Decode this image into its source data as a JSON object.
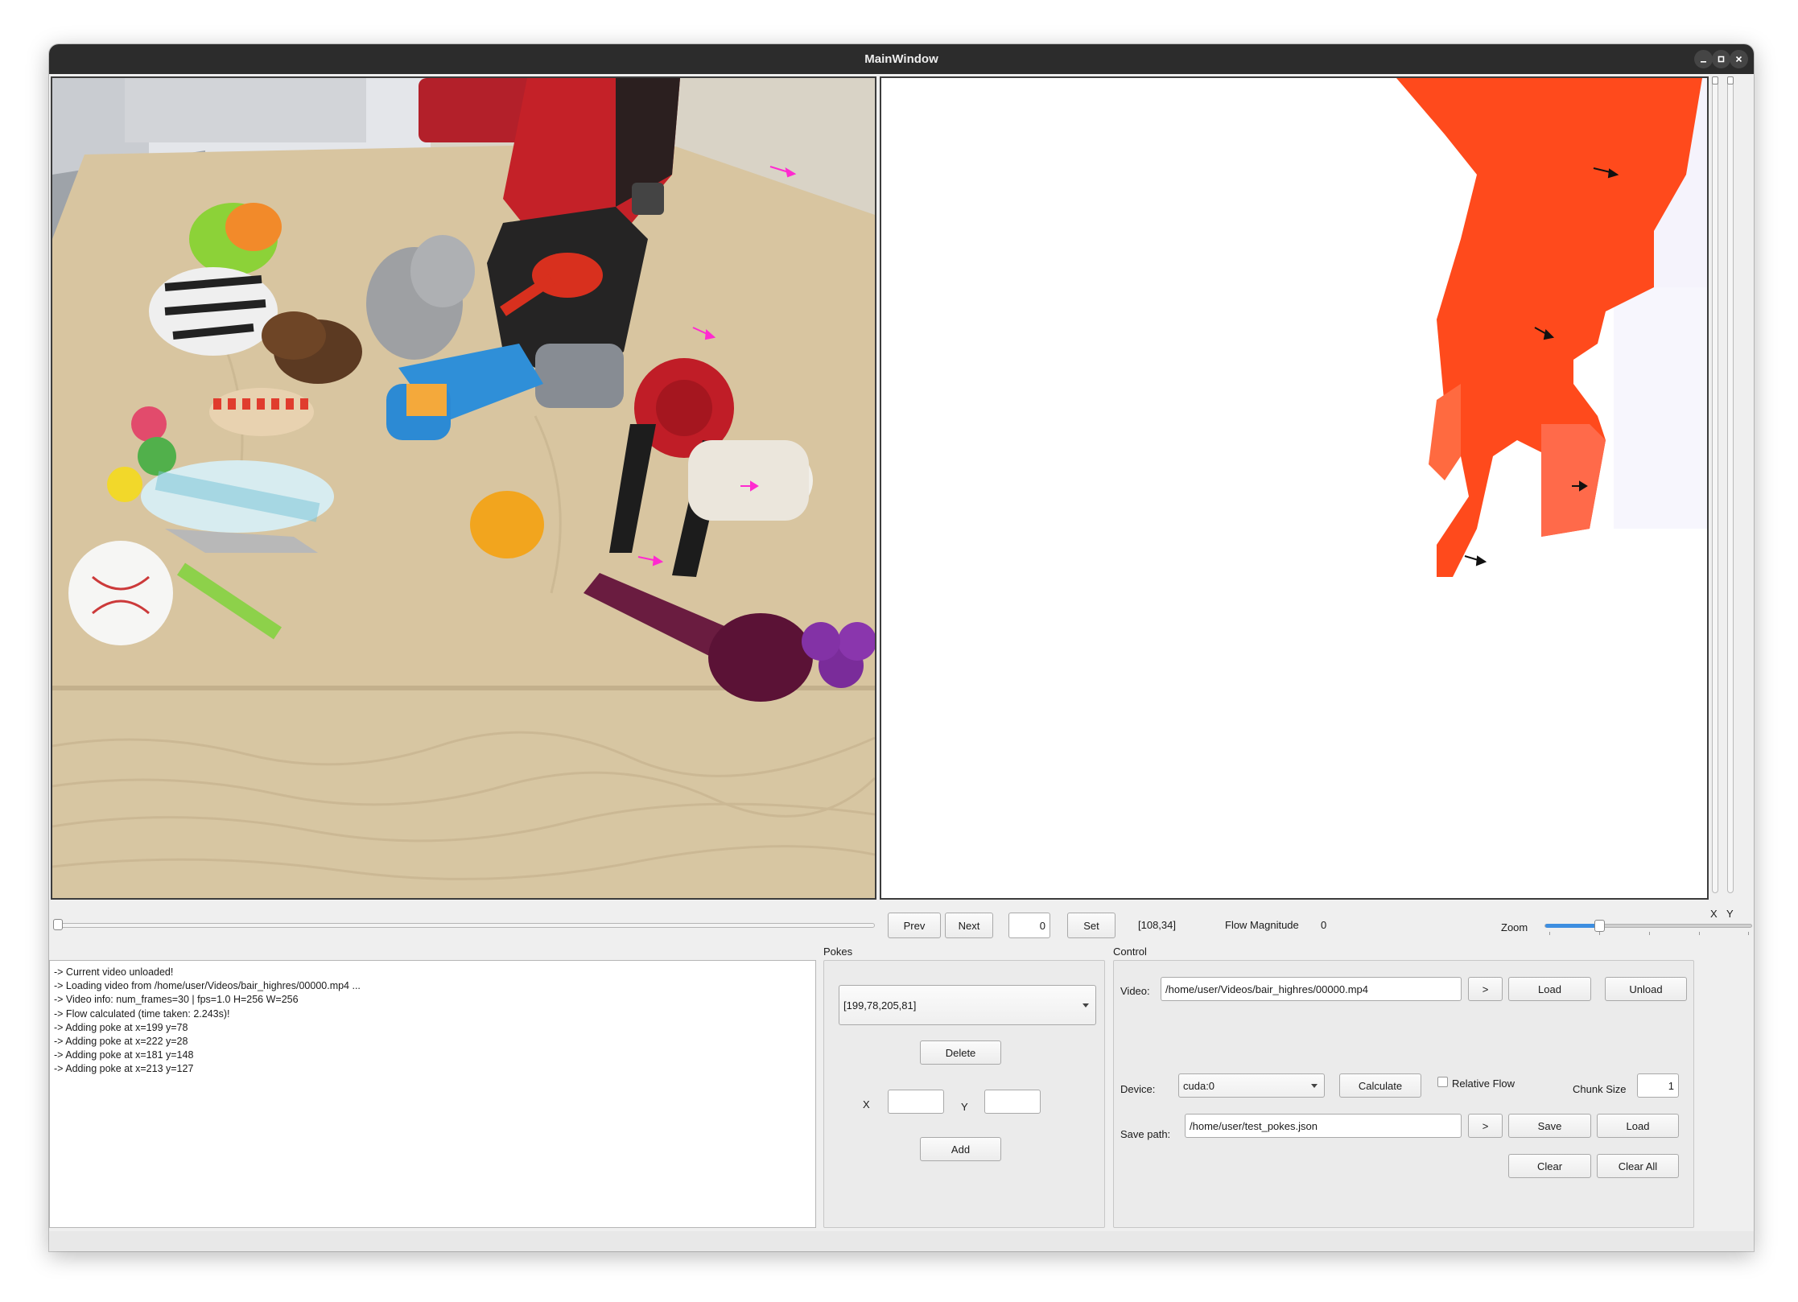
{
  "window": {
    "title": "MainWindow"
  },
  "window_controls": {
    "minimize": "minimize-icon",
    "maximize": "maximize-icon",
    "close": "close-icon"
  },
  "axes": {
    "x_label": "X",
    "y_label": "Y"
  },
  "frame_nav": {
    "prev_label": "Prev",
    "next_label": "Next",
    "frame_value": "0",
    "set_label": "Set",
    "coords": "[108,34]",
    "flow_magnitude_label": "Flow Magnitude",
    "flow_magnitude_value": "0",
    "zoom_label": "Zoom",
    "zoom_level": 0.26,
    "timeline_position": 0.0
  },
  "log": {
    "lines": [
      "-> Current video unloaded!",
      "-> Loading video from /home/user/Videos/bair_highres/00000.mp4 ...",
      "-> Video info: num_frames=30 | fps=1.0 H=256 W=256",
      "-> Flow calculated (time taken: 2.243s)!",
      "-> Adding poke at x=199 y=78",
      "-> Adding poke at x=222 y=28",
      "-> Adding poke at x=181 y=148",
      "-> Adding poke at x=213 y=127"
    ]
  },
  "pokes": {
    "title": "Pokes",
    "selected": "[199,78,205,81]",
    "delete_label": "Delete",
    "x_label": "X",
    "y_label": "Y",
    "x_value": "",
    "y_value": "",
    "add_label": "Add"
  },
  "control": {
    "title": "Control",
    "video_label": "Video:",
    "video_path": "/home/user/Videos/bair_highres/00000.mp4",
    "browse_label": ">",
    "load_label": "Load",
    "unload_label": "Unload",
    "device_label": "Device:",
    "device_value": "cuda:0",
    "calculate_label": "Calculate",
    "relative_flow_label": "Relative Flow",
    "relative_flow_checked": false,
    "chunk_size_label": "Chunk Size",
    "chunk_size_value": "1",
    "save_path_label": "Save path:",
    "save_path": "/home/user/test_pokes.json",
    "save_browse_label": ">",
    "save_label": "Save",
    "load_pokes_label": "Load",
    "clear_label": "Clear",
    "clear_all_label": "Clear All"
  },
  "colors": {
    "titlebar": "#2c2c2c",
    "poke_arrow_left": "#ff2ad0",
    "poke_arrow_right": "#111111",
    "flow_region": "#ff4a1c",
    "accent": "#3d8ee0"
  }
}
